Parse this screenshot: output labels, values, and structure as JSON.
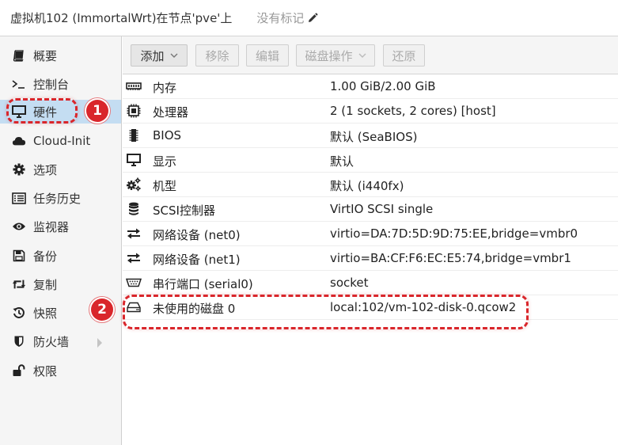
{
  "header": {
    "title": "虚拟机102 (ImmortalWrt)在节点'pve'上",
    "tags_label": "没有标记"
  },
  "sidebar": {
    "items": [
      {
        "label": "概要",
        "icon": "book-icon"
      },
      {
        "label": "控制台",
        "icon": "terminal-icon"
      },
      {
        "label": "硬件",
        "icon": "monitor-icon",
        "active": true
      },
      {
        "label": "Cloud-Init",
        "icon": "cloud-icon"
      },
      {
        "label": "选项",
        "icon": "gear-icon"
      },
      {
        "label": "任务历史",
        "icon": "list-icon"
      },
      {
        "label": "监视器",
        "icon": "eye-icon"
      },
      {
        "label": "备份",
        "icon": "floppy-icon"
      },
      {
        "label": "复制",
        "icon": "retweet-icon"
      },
      {
        "label": "快照",
        "icon": "history-icon"
      },
      {
        "label": "防火墙",
        "icon": "shield-icon"
      },
      {
        "label": "权限",
        "icon": "unlock-icon"
      }
    ]
  },
  "toolbar": {
    "add_label": "添加",
    "remove_label": "移除",
    "edit_label": "编辑",
    "disk_action_label": "磁盘操作",
    "revert_label": "还原"
  },
  "hardware": {
    "rows": [
      {
        "name": "内存",
        "value": "1.00 GiB/2.00 GiB",
        "icon": "memory-icon"
      },
      {
        "name": "处理器",
        "value": "2 (1 sockets, 2 cores) [host]",
        "icon": "cpu-icon"
      },
      {
        "name": "BIOS",
        "value": "默认 (SeaBIOS)",
        "icon": "microchip-icon"
      },
      {
        "name": "显示",
        "value": "默认",
        "icon": "desktop-icon"
      },
      {
        "name": "机型",
        "value": "默认 (i440fx)",
        "icon": "cogs-icon"
      },
      {
        "name": "SCSI控制器",
        "value": "VirtIO SCSI single",
        "icon": "database-icon"
      },
      {
        "name": "网络设备 (net0)",
        "value": "virtio=DA:7D:5D:9D:75:EE,bridge=vmbr0",
        "icon": "exchange-icon"
      },
      {
        "name": "网络设备 (net1)",
        "value": "virtio=BA:CF:F6:EC:E5:74,bridge=vmbr1",
        "icon": "exchange-icon"
      },
      {
        "name": "串行端口 (serial0)",
        "value": "socket",
        "icon": "serial-port-icon"
      },
      {
        "name": "未使用的磁盘 0",
        "value": "local:102/vm-102-disk-0.qcow2",
        "icon": "hdd-icon"
      }
    ]
  },
  "annotations": {
    "badge1": "1",
    "badge2": "2"
  }
}
